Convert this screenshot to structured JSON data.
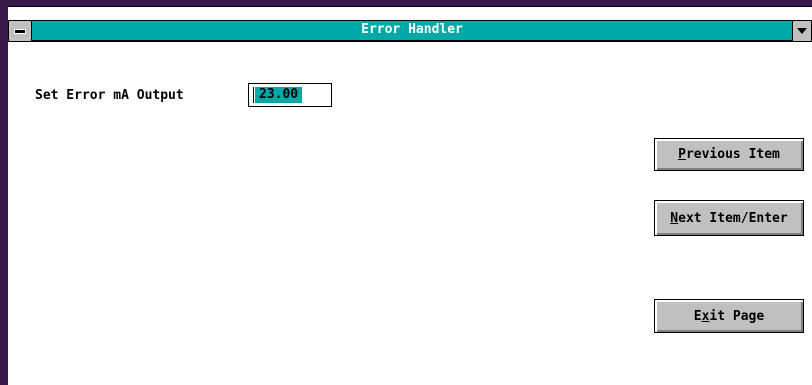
{
  "window": {
    "title": "Error Handler"
  },
  "form": {
    "field_label": "Set Error mA Output",
    "field_value": "23.00"
  },
  "buttons": {
    "previous": {
      "accel": "P",
      "rest": "revious Item"
    },
    "next": {
      "accel": "N",
      "rest": "ext Item/Enter"
    },
    "exit": {
      "pre": "E",
      "accel": "x",
      "rest": "it Page"
    }
  },
  "colors": {
    "titlebar": "#00a8a8",
    "button_face": "#c0c0c0",
    "field_highlight": "#00a8a8",
    "frame": "#3a1a4a"
  },
  "icons": {
    "system_menu": "system-menu-icon",
    "scroll_down": "chevron-down-icon"
  }
}
